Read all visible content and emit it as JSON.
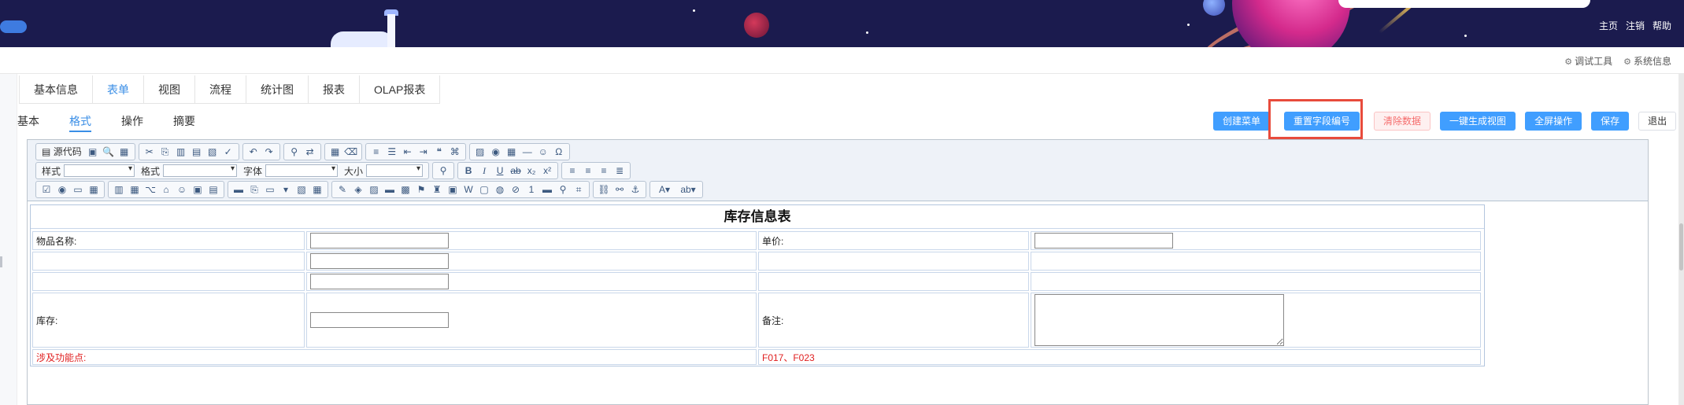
{
  "header": {
    "nav_links": [
      "主页",
      "注销",
      "帮助"
    ],
    "colors": {
      "banner_bg": "#1b1b4e",
      "accent": "#409eff",
      "highlight": "#e84b3c"
    }
  },
  "subheader": {
    "debug_tool": "调试工具",
    "system_info": "系统信息"
  },
  "main_tabs": [
    {
      "label": "基本信息",
      "active": false
    },
    {
      "label": "表单",
      "active": true
    },
    {
      "label": "视图",
      "active": false
    },
    {
      "label": "流程",
      "active": false
    },
    {
      "label": "统计图",
      "active": false
    },
    {
      "label": "报表",
      "active": false
    },
    {
      "label": "OLAP报表",
      "active": false
    }
  ],
  "sub_tabs": [
    {
      "label": "基本",
      "active": false
    },
    {
      "label": "格式",
      "active": true
    },
    {
      "label": "操作",
      "active": false
    },
    {
      "label": "摘要",
      "active": false
    }
  ],
  "actions": {
    "create_menu": "创建菜单",
    "reset_field_no": "重置字段编号",
    "clear_data": "清除数据",
    "generate_view": "一键生成视图",
    "fullscreen": "全屏操作",
    "save": "保存",
    "exit": "退出"
  },
  "editor_toolbar": {
    "source_code": "源代码",
    "style_label": "样式",
    "format_label": "格式",
    "font_label": "字体",
    "size_label": "大小"
  },
  "form": {
    "title": "库存信息表",
    "item_name_label": "物品名称:",
    "unit_price_label": "单价:",
    "stock_label": "库存:",
    "remark_label": "备注:",
    "feature_label": "涉及功能点:",
    "feature_value": "F017、F023"
  }
}
